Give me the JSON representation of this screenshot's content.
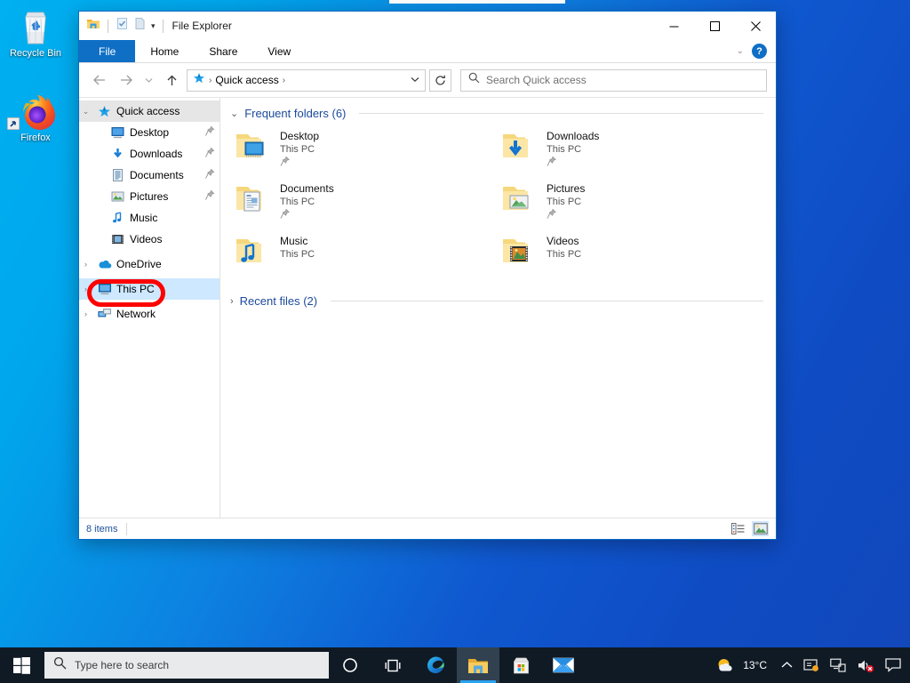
{
  "desktop": {
    "icons": [
      {
        "label": "Recycle Bin",
        "icon": "recycle-bin-icon"
      },
      {
        "label": "Firefox",
        "icon": "firefox-icon"
      }
    ]
  },
  "window": {
    "title": "File Explorer",
    "quick_access_toolbar": [
      {
        "name": "explorer-icon",
        "label": ""
      },
      {
        "name": "properties-icon",
        "label": ""
      },
      {
        "name": "new-folder-icon",
        "label": ""
      },
      {
        "name": "customize-qat-caret",
        "label": "▾"
      }
    ],
    "controls": {
      "minimize": "—",
      "maximize": "▢",
      "close": "✕",
      "ribbon_expand": "⌄",
      "help": "?"
    },
    "ribbon_tabs": [
      {
        "label": "File",
        "active": true
      },
      {
        "label": "Home",
        "active": false
      },
      {
        "label": "Share",
        "active": false
      },
      {
        "label": "View",
        "active": false
      }
    ],
    "address": {
      "back": "←",
      "forward": "→",
      "recent_caret": "⌄",
      "up": "↑",
      "crumb_icon": "quick-access-star-icon",
      "crumb": "Quick access",
      "crumb_sep": "›",
      "dropdown_caret": "⌄",
      "refresh": "↻"
    },
    "search": {
      "icon": "search-icon",
      "placeholder": "Search Quick access"
    }
  },
  "navpane": {
    "items": [
      {
        "label": "Quick access",
        "chevron": "⌄",
        "icon": "star-icon",
        "indent": false,
        "header": true,
        "pinned": false,
        "selected": false
      },
      {
        "label": "Desktop",
        "chevron": "",
        "icon": "desktop-icon",
        "indent": true,
        "header": false,
        "pinned": true,
        "selected": false
      },
      {
        "label": "Downloads",
        "chevron": "",
        "icon": "downloads-icon",
        "indent": true,
        "header": false,
        "pinned": true,
        "selected": false
      },
      {
        "label": "Documents",
        "chevron": "",
        "icon": "documents-icon",
        "indent": true,
        "header": false,
        "pinned": true,
        "selected": false
      },
      {
        "label": "Pictures",
        "chevron": "",
        "icon": "pictures-icon",
        "indent": true,
        "header": false,
        "pinned": true,
        "selected": false
      },
      {
        "label": "Music",
        "chevron": "",
        "icon": "music-icon",
        "indent": true,
        "header": false,
        "pinned": false,
        "selected": false
      },
      {
        "label": "Videos",
        "chevron": "",
        "icon": "videos-icon",
        "indent": true,
        "header": false,
        "pinned": false,
        "selected": false
      },
      {
        "label": "OneDrive",
        "chevron": "›",
        "icon": "onedrive-cloud-icon",
        "indent": false,
        "header": false,
        "pinned": false,
        "selected": false
      },
      {
        "label": "This PC",
        "chevron": "›",
        "icon": "this-pc-icon",
        "indent": false,
        "header": false,
        "pinned": false,
        "selected": true
      },
      {
        "label": "Network",
        "chevron": "›",
        "icon": "network-icon",
        "indent": false,
        "header": false,
        "pinned": false,
        "selected": false
      }
    ],
    "annotation": {
      "target": "This PC",
      "color": "#fe0000"
    },
    "pin_glyph": "📌"
  },
  "content": {
    "frequent": {
      "chevron": "⌄",
      "title": "Frequent folders (6)",
      "tiles": [
        {
          "name": "Desktop",
          "sub": "This PC",
          "pinned": true,
          "icon": "folder-desktop-icon"
        },
        {
          "name": "Downloads",
          "sub": "This PC",
          "pinned": true,
          "icon": "folder-downloads-icon"
        },
        {
          "name": "Documents",
          "sub": "This PC",
          "pinned": true,
          "icon": "folder-documents-icon"
        },
        {
          "name": "Pictures",
          "sub": "This PC",
          "pinned": true,
          "icon": "folder-pictures-icon"
        },
        {
          "name": "Music",
          "sub": "This PC",
          "pinned": false,
          "icon": "folder-music-icon"
        },
        {
          "name": "Videos",
          "sub": "This PC",
          "pinned": false,
          "icon": "folder-videos-icon"
        }
      ]
    },
    "recent": {
      "chevron": "›",
      "title": "Recent files (2)"
    }
  },
  "statusbar": {
    "items_text": "8 items",
    "views": [
      {
        "name": "details-view-button",
        "active": false
      },
      {
        "name": "large-icons-view-button",
        "active": true
      }
    ]
  },
  "taskbar": {
    "start": "start-icon",
    "search": {
      "icon": "search-icon",
      "placeholder": "Type here to search"
    },
    "buttons": [
      {
        "name": "cortana-icon"
      },
      {
        "name": "task-view-icon"
      },
      {
        "name": "edge-icon"
      },
      {
        "name": "file-explorer-icon",
        "active": true
      },
      {
        "name": "microsoft-store-icon"
      },
      {
        "name": "mail-icon"
      }
    ],
    "tray": {
      "weather_icon": "weather-partly-sunny-icon",
      "temperature": "13°C",
      "chevron": "⌃",
      "icons": [
        "onedrive-tray-icon",
        "network-tray-icon",
        "volume-muted-icon"
      ],
      "action_center": "action-center-icon"
    }
  },
  "colors": {
    "accent": "#0f6fc5",
    "annotation": "#fe0000",
    "selection": "#cde8ff",
    "group_heading": "#1c4a9c"
  }
}
